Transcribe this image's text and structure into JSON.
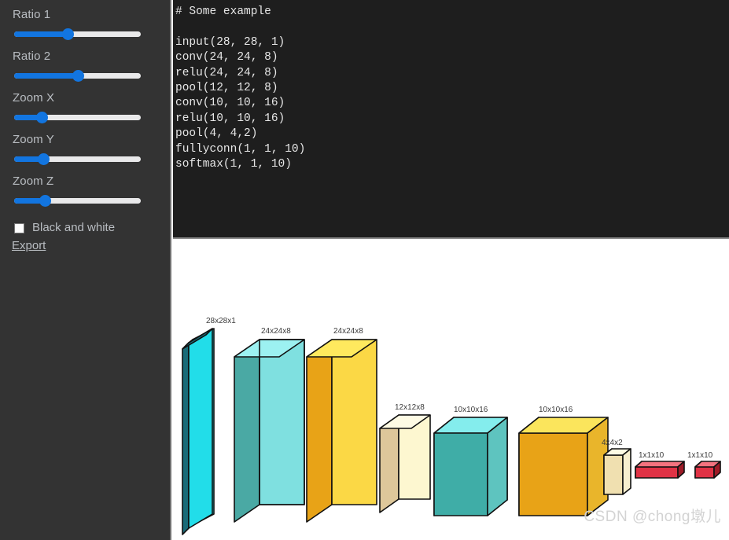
{
  "sidebar": {
    "sliders": [
      {
        "label": "Ratio 1",
        "value_pct": 42,
        "name": "ratio-1"
      },
      {
        "label": "Ratio 2",
        "value_pct": 50,
        "name": "ratio-2"
      },
      {
        "label": "Zoom X",
        "value_pct": 22,
        "name": "zoom-x"
      },
      {
        "label": "Zoom Y",
        "value_pct": 23,
        "name": "zoom-y"
      },
      {
        "label": "Zoom Z",
        "value_pct": 24,
        "name": "zoom-z"
      }
    ],
    "checkbox": {
      "label": "Black and white",
      "checked": false
    },
    "export_label": "Export"
  },
  "code": {
    "text": "# Some example\n\ninput(28, 28, 1)\nconv(24, 24, 8)\nrelu(24, 24, 8)\npool(12, 12, 8)\nconv(10, 10, 16)\nrelu(10, 10, 16)\npool(4, 4,2)\nfullyconn(1, 1, 10)\nsoftmax(1, 1, 10)"
  },
  "diagram": {
    "watermark": "CSDN @chong墩儿",
    "layers": [
      {
        "label": "28x28x1",
        "kind": "plate",
        "color": "cyan"
      },
      {
        "label": "24x24x8",
        "kind": "box",
        "color": "teal"
      },
      {
        "label": "24x24x8",
        "kind": "box",
        "color": "yellow"
      },
      {
        "label": "12x12x8",
        "kind": "box",
        "color": "cream"
      },
      {
        "label": "10x10x16",
        "kind": "box",
        "color": "teal"
      },
      {
        "label": "10x10x16",
        "kind": "box",
        "color": "yellow"
      },
      {
        "label": "4x4x2",
        "kind": "box",
        "color": "cream"
      },
      {
        "label": "1x1x10",
        "kind": "bar",
        "color": "red"
      },
      {
        "label": "1x1x10",
        "kind": "bar",
        "color": "red"
      }
    ]
  },
  "colors": {
    "sidebar_bg": "#333333",
    "code_bg": "#1e1e1e",
    "accent_blue": "#1275e0",
    "cyan_front": "#22ddee",
    "teal_front": "#7fe0e0",
    "teal_side": "#4aa9a4",
    "teal_top": "#9cf1f1",
    "yellow_front": "#fbd845",
    "yellow_side": "#e8a317",
    "yellow_top": "#ffe95e",
    "cream_front": "#fdf7d0",
    "cream_side": "#ddc79a",
    "cream_top": "#fdf9dd",
    "red_front": "#e03245",
    "red_top": "#f4737f"
  }
}
